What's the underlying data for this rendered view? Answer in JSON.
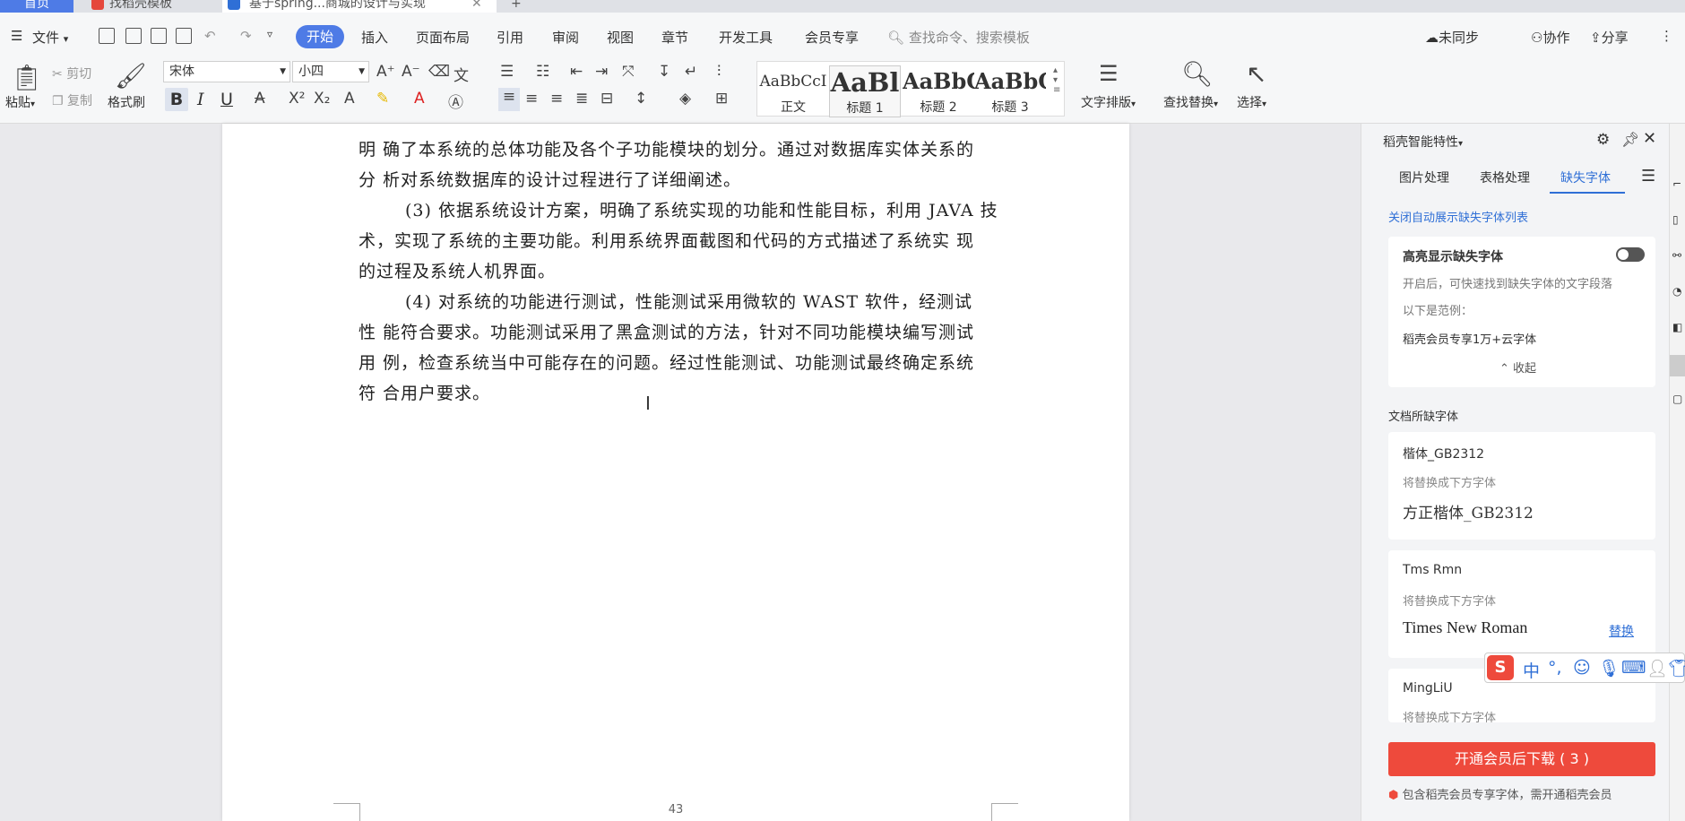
{
  "tabs": {
    "home": "首页",
    "template": "找稻壳模板",
    "document": "基于spring...商城的设计与实现"
  },
  "menu": {
    "file": "文件",
    "items": [
      "开始",
      "插入",
      "页面布局",
      "引用",
      "审阅",
      "视图",
      "章节",
      "开发工具",
      "会员专享"
    ],
    "search_placeholder": "查找命令、搜索模板",
    "unsynced": "未同步",
    "collab": "协作",
    "share": "分享"
  },
  "ribbon": {
    "paste": "粘贴",
    "cut": "剪切",
    "copy": "复制",
    "format_painter": "格式刷",
    "font": "宋体",
    "size": "小四",
    "bold": "B",
    "italic": "I",
    "underline": "U",
    "styles": [
      {
        "preview": "AaBbCcI",
        "name": "正文"
      },
      {
        "preview": "AaBl",
        "name": "标题 1"
      },
      {
        "preview": "AaBbC",
        "name": "标题 2"
      },
      {
        "preview": "AaBbC",
        "name": "标题 3"
      }
    ],
    "text_layout": "文字排版",
    "find_replace": "查找替换",
    "select": "选择"
  },
  "document": {
    "lines": [
      "明 确了本系统的总体功能及各个子功能模块的划分。通过对数据库实体关系的",
      "分 析对系统数据库的设计过程进行了详细阐述。",
      "(3) 依据系统设计方案，明确了系统实现的功能和性能目标，利用 JAVA 技",
      "术，实现了系统的主要功能。利用系统界面截图和代码的方式描述了系统实 现",
      "的过程及系统人机界面。",
      "(4) 对系统的功能进行测试，性能测试采用微软的 WAST 软件，经测试",
      "性 能符合要求。功能测试采用了黑盒测试的方法，针对不同功能模块编写测试",
      "用 例，检查系统当中可能存在的问题。经过性能测试、功能测试最终确定系统",
      "符 合用户要求。"
    ],
    "page_number": "43"
  },
  "panel": {
    "title": "稻壳智能特性",
    "tabs": [
      "图片处理",
      "表格处理",
      "缺失字体"
    ],
    "close_auto": "关闭自动展示缺失字体列表",
    "highlight_title": "高亮显示缺失字体",
    "highlight_desc": "开启后，可快速找到缺失字体的文字段落",
    "example_label": "以下是范例：",
    "example_text": "稻壳会员专享1万+云字体",
    "collapse": "收起",
    "missing_title": "文档所缺字体",
    "fonts": [
      {
        "name": "楷体_GB2312",
        "hint": "将替换成下方字体",
        "replacement": "方正楷体_GB2312",
        "action": ""
      },
      {
        "name": "Tms Rmn",
        "hint": "将替换成下方字体",
        "replacement": "Times New Roman",
        "action": "替换"
      },
      {
        "name": "MingLiU",
        "hint": "将替换成下方字体",
        "replacement": "",
        "action": ""
      }
    ],
    "download_button": "开通会员后下载 ( 3 )",
    "footer_note": "包含稻壳会员专享字体，需开通稻壳会员"
  },
  "ime": {
    "lang": "中",
    "punct": "°,"
  },
  "colors": {
    "accent": "#4e7be6",
    "download": "#ee4a3c",
    "link": "#2f6fd6"
  }
}
